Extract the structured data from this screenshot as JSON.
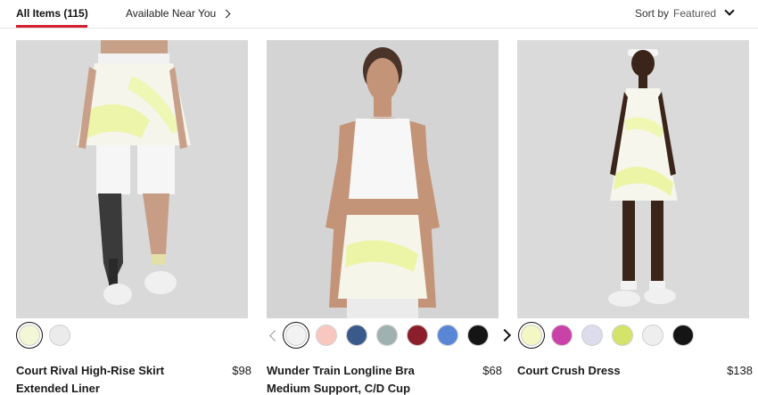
{
  "filter_bar": {
    "all_items_label": "All Items (115)",
    "available_near_label": "Available Near You",
    "sort_label": "Sort by",
    "sort_value": "Featured"
  },
  "products": [
    {
      "name_line1": "Court Rival High-Rise Skirt",
      "name_line2": "Extended Liner",
      "price": "$98",
      "swatches": [
        "#f4f7d6",
        "#ebebeb"
      ]
    },
    {
      "name_line1": "Wunder Train Longline Bra",
      "name_line2": "Medium Support, C/D Cup",
      "price": "$68",
      "swatches": [
        "#f2f2f2",
        "#f8c8c0",
        "#3b5a8c",
        "#9fb2b0",
        "#8a1e2a",
        "#5a86d6",
        "#151515"
      ]
    },
    {
      "name_line1": "Court Crush Dress",
      "name_line2": "",
      "price": "$138",
      "swatches": [
        "#f3f7c4",
        "#c942a8",
        "#dcdcec",
        "#d4e36a",
        "#eeeeee",
        "#151515"
      ]
    }
  ],
  "colors": {
    "accent": "#d31f2f"
  }
}
